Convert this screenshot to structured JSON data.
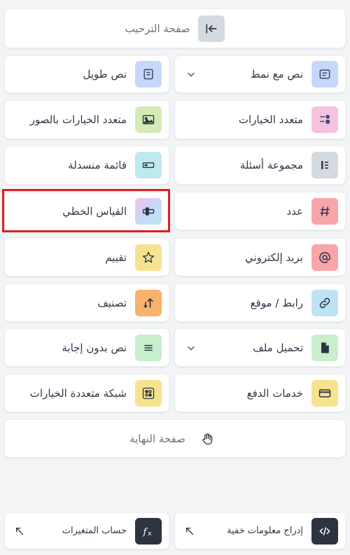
{
  "welcome": {
    "label": "صفحة الترحيب"
  },
  "items": [
    {
      "label": "نص مع نمط"
    },
    {
      "label": "نص طويل"
    },
    {
      "label": "متعدد الخيارات"
    },
    {
      "label": "متعدد الخيارات بالصور"
    },
    {
      "label": "مجموعة أسئلة"
    },
    {
      "label": "قائمة منسدلة"
    },
    {
      "label": "عدد"
    },
    {
      "label": "القياس الخطي"
    },
    {
      "label": "بريد إلكتروني"
    },
    {
      "label": "تقييم"
    },
    {
      "label": "رابط / موقع"
    },
    {
      "label": "تصنيف"
    },
    {
      "label": "تحميل ملف"
    },
    {
      "label": "نص بدون إجابة"
    },
    {
      "label": "خدمات الدفع"
    },
    {
      "label": "شبكة متعددة الخيارات"
    }
  ],
  "end_page": {
    "label": "صفحة النهاية"
  },
  "bottom": {
    "hidden": {
      "label": "إدراج معلومات خفية"
    },
    "calc": {
      "label": "حساب المتغيرات"
    }
  },
  "icons": {
    "welcome": "arrow-to-left-icon",
    "styled_text": "text-box-icon",
    "long_text": "document-icon",
    "multi_choice": "choices-icon",
    "image_choice": "image-icon",
    "question_group": "group-icon",
    "dropdown": "dropdown-icon",
    "number": "hash-icon",
    "linear_scale": "slider-icon",
    "email": "at-icon",
    "rating": "star-icon",
    "link": "link-icon",
    "ranking": "sort-icon",
    "file_upload": "file-icon",
    "statement": "lines-icon",
    "payment": "card-icon",
    "grid": "grid-icon",
    "end": "wave-hand-icon",
    "hidden": "code-icon",
    "calc": "fx-icon"
  },
  "colors": {
    "highlight": "#e01e23",
    "blue_icon_bg": "#c7d7fb",
    "pink_icon_bg": "#f6c2e0",
    "green_icon_bg": "#d4ebb7",
    "gray_icon_bg": "#d5dae1",
    "cyan_icon_bg": "#bfe9ec",
    "red_icon_bg": "#f8a5aa",
    "yellow_icon_bg": "#f7e38f",
    "orange_icon_bg": "#f7b26b",
    "lightblue_icon_bg": "#bde3f4",
    "mint_icon_bg": "#c8eecb",
    "dark_icon_bg": "#2d3440"
  }
}
